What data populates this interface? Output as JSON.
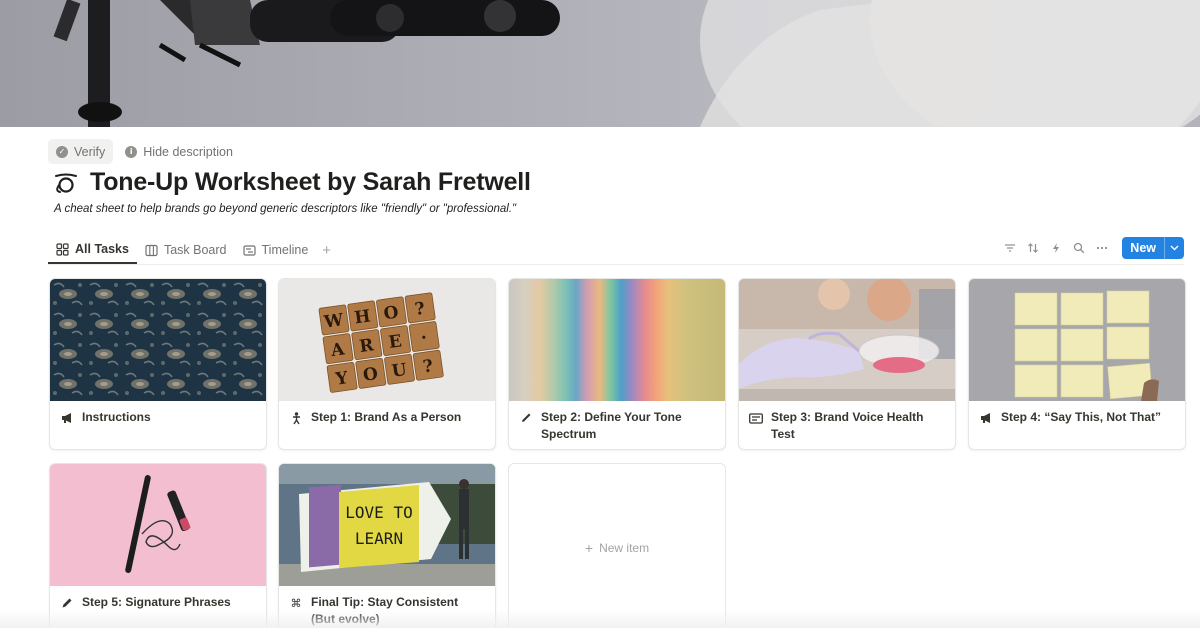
{
  "header": {
    "verify_label": "Verify",
    "hide_description_label": "Hide description",
    "title": "Tone-Up Worksheet by Sarah Fretwell",
    "description": "A cheat sheet to help brands go beyond generic descriptors like \"friendly\" or \"professional.\""
  },
  "tabs": [
    {
      "label": "All Tasks",
      "icon": "gallery-icon",
      "active": true
    },
    {
      "label": "Task Board",
      "icon": "board-icon"
    },
    {
      "label": "Timeline",
      "icon": "timeline-icon"
    }
  ],
  "toolbar": {
    "icons": [
      "filter-icon",
      "sort-icon",
      "automation-icon",
      "search-icon",
      "more-icon"
    ],
    "new_label": "New"
  },
  "cards": [
    {
      "title": "Instructions",
      "icon": "megaphone-icon",
      "cover": "damask-pattern"
    },
    {
      "title": "Step 1: Brand As a Person",
      "icon": "person-icon",
      "cover": "scrabble-tiles"
    },
    {
      "title": "Step 2: Define Your Tone Spectrum",
      "icon": "pencil-icon",
      "cover": "color-gradient"
    },
    {
      "title": "Step 3: Brand Voice Health Test",
      "icon": "id-card-icon",
      "cover": "lab-petri-dish"
    },
    {
      "title": "Step 4: “Say This, Not That”",
      "icon": "megaphone-icon",
      "cover": "sticky-notes"
    },
    {
      "title": "Step 5: Signature Phrases",
      "icon": "pen-icon",
      "cover": "pink-pen"
    },
    {
      "title": "Final Tip: Stay Consistent (But evolve)",
      "icon": "command-icon",
      "cover": "love-to-learn-sign"
    }
  ],
  "new_item_label": "New item",
  "colors": {
    "accent": "#2383e2",
    "text": "#37352f",
    "muted": "#73726e"
  }
}
